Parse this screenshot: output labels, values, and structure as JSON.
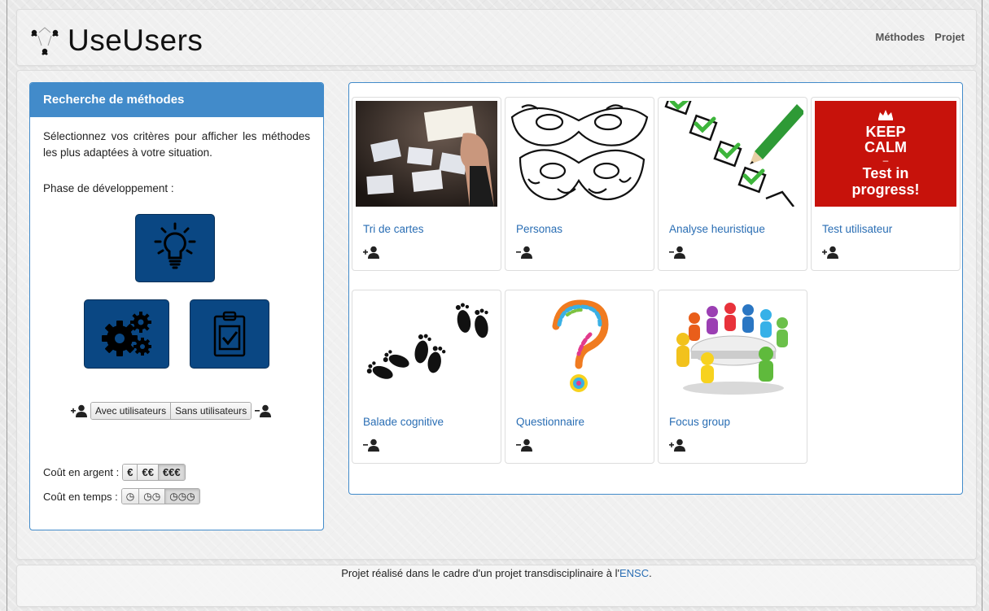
{
  "header": {
    "logo_text": "UseUsers",
    "nav": [
      "Méthodes",
      "Projet"
    ]
  },
  "sidebar": {
    "title": "Recherche de méthodes",
    "intro": "Sélectionnez vos critères pour afficher les méthodes les plus adaptées à votre situation.",
    "phase_label": "Phase de développement :",
    "phase_buttons": [
      "lightbulb-icon",
      "gears-icon",
      "clipboard-check-icon"
    ],
    "user_toggle": {
      "with_users": "Avec utilisateurs",
      "without_users": "Sans utilisateurs"
    },
    "cost_money": {
      "label": "Coût en argent :",
      "options": [
        "€",
        "€€",
        "€€€"
      ],
      "selected": "€€€"
    },
    "cost_time": {
      "label": "Coût en temps :",
      "options": [
        "◷",
        "◷◷",
        "◷◷◷"
      ],
      "selected": "◷◷◷"
    }
  },
  "methods": [
    {
      "title": "Tri de cartes",
      "users": "with-users"
    },
    {
      "title": "Personas",
      "users": "without-users"
    },
    {
      "title": "Analyse heuristique",
      "users": "without-users"
    },
    {
      "title": "Test utilisateur",
      "users": "with-users"
    },
    {
      "title": "Balade cognitive",
      "users": "without-users"
    },
    {
      "title": "Questionnaire",
      "users": "without-users"
    },
    {
      "title": "Focus group",
      "users": "with-users"
    }
  ],
  "keep_calm": {
    "line1": "KEEP",
    "line2": "CALM",
    "dash": "–",
    "line3": "Test in",
    "line4": "progress!"
  },
  "footer": {
    "text_before": "Projet réalisé dans le cadre d'un projet transdisciplinaire à l'",
    "link": "ENSC",
    "text_after": "."
  },
  "colors": {
    "primary": "#428bca",
    "phase_button": "#0a4783",
    "link": "#2a6eb4",
    "keep_calm_red": "#c7120b"
  }
}
